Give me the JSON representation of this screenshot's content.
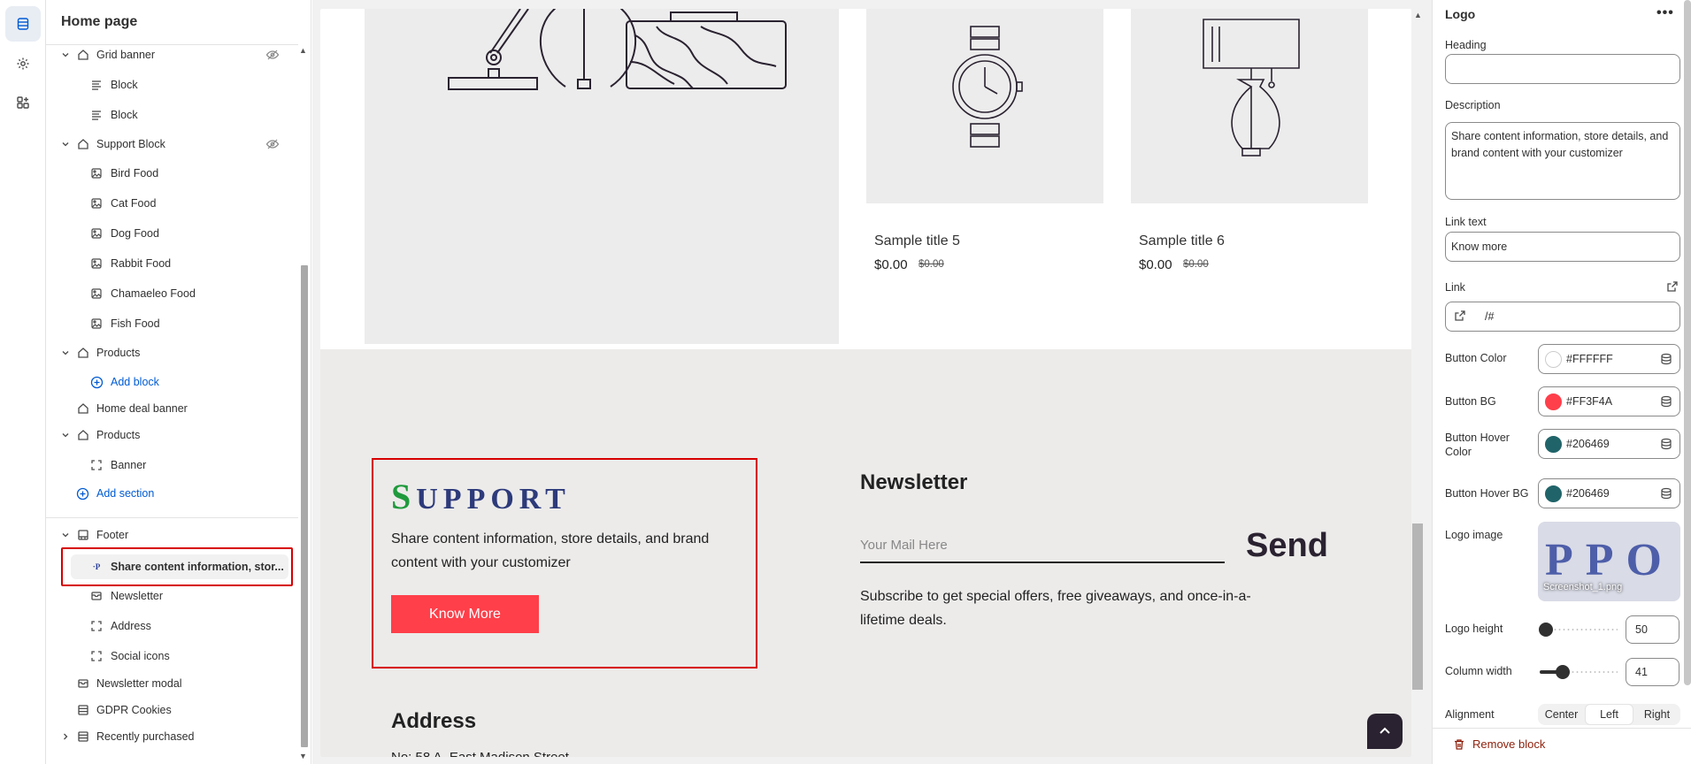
{
  "sidebar": {
    "title": "Home page",
    "items": [
      {
        "label": "Grid banner"
      },
      {
        "label": "Block"
      },
      {
        "label": "Block"
      },
      {
        "label": "Support Block"
      },
      {
        "label": "Bird Food"
      },
      {
        "label": "Cat Food"
      },
      {
        "label": "Dog Food"
      },
      {
        "label": "Rabbit Food"
      },
      {
        "label": "Chamaeleo Food"
      },
      {
        "label": "Fish Food"
      },
      {
        "label": "Products"
      },
      {
        "label": "Add block"
      },
      {
        "label": "Home deal banner"
      },
      {
        "label": "Products"
      },
      {
        "label": "Banner"
      },
      {
        "label": "Add section"
      },
      {
        "label": "Footer"
      },
      {
        "label": "Share content information, stor..."
      },
      {
        "label": "Newsletter"
      },
      {
        "label": "Address"
      },
      {
        "label": "Social icons"
      },
      {
        "label": "Newsletter modal"
      },
      {
        "label": "GDPR Cookies"
      },
      {
        "label": "Recently purchased"
      }
    ]
  },
  "preview": {
    "products": [
      {
        "title": "Sample title 5",
        "price": "$0.00",
        "old_price": "$0.00"
      },
      {
        "title": "Sample title 6",
        "price": "$0.00",
        "old_price": "$0.00"
      }
    ],
    "support": {
      "logo_first": "S",
      "logo_rest": "UPPORT",
      "description": "Share content information, store details, and brand content with your customizer",
      "button": "Know More"
    },
    "newsletter": {
      "title": "Newsletter",
      "placeholder": "Your Mail Here",
      "send": "Send",
      "description": "Subscribe to get special offers, free giveaways, and once-in-a-lifetime deals."
    },
    "address": {
      "title": "Address",
      "line": "No: 58 A, East Madison Street"
    }
  },
  "settings": {
    "title": "Logo",
    "more": "•••",
    "heading_label": "Heading",
    "heading_value": "",
    "description_label": "Description",
    "description_value": "Share content information, store details, and brand content with your customizer",
    "link_text_label": "Link text",
    "link_text_value": "Know more",
    "link_label": "Link",
    "link_value": "/#",
    "colors": [
      {
        "label": "Button Color",
        "hex": "#FFFFFF",
        "swatch": "#FFFFFF"
      },
      {
        "label": "Button BG",
        "hex": "#FF3F4A",
        "swatch": "#FF3F4A"
      },
      {
        "label": "Button Hover Color",
        "hex": "#206469",
        "swatch": "#206469"
      },
      {
        "label": "Button Hover BG",
        "hex": "#206469",
        "swatch": "#206469"
      }
    ],
    "logo_image_label": "Logo image",
    "logo_image_preview_text": "PPO",
    "logo_image_name": "Screenshot_1.png",
    "logo_height_label": "Logo height",
    "logo_height_value": "50",
    "logo_height_fraction": 0.08,
    "column_width_label": "Column width",
    "column_width_value": "41",
    "column_width_fraction": 0.29,
    "alignment_label": "Alignment",
    "alignment_options": [
      "Center",
      "Left",
      "Right"
    ],
    "alignment_selected": "Left",
    "remove_label": "Remove block"
  },
  "colors": {
    "accent": "#FF3F4A",
    "selection": "#D70000",
    "link": "#005BD3"
  }
}
